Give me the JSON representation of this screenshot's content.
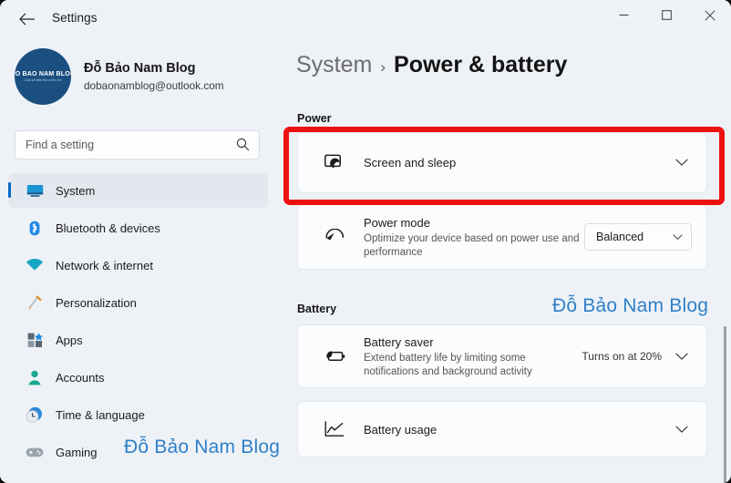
{
  "window": {
    "title": "Settings",
    "back_icon": "back-arrow-icon",
    "controls": {
      "minimize": "minimize-icon",
      "maximize": "maximize-icon",
      "close": "close-icon"
    }
  },
  "account": {
    "avatar_line1": "ĐO BAO NAM BLOG",
    "avatar_line2": "Chia sẻ kiến thức hữu ích",
    "name": "Đỗ Bảo Nam Blog",
    "email": "dobaonamblog@outlook.com"
  },
  "search": {
    "placeholder": "Find a setting",
    "value": "",
    "icon": "search-icon"
  },
  "sidebar": {
    "items": [
      {
        "label": "System",
        "icon": "monitor-icon",
        "active": true
      },
      {
        "label": "Bluetooth & devices",
        "icon": "bluetooth-icon",
        "active": false
      },
      {
        "label": "Network & internet",
        "icon": "wifi-icon",
        "active": false
      },
      {
        "label": "Personalization",
        "icon": "paintbrush-icon",
        "active": false
      },
      {
        "label": "Apps",
        "icon": "apps-grid-icon",
        "active": false
      },
      {
        "label": "Accounts",
        "icon": "person-icon",
        "active": false
      },
      {
        "label": "Time & language",
        "icon": "clock-icon",
        "active": false
      },
      {
        "label": "Gaming",
        "icon": "gamepad-icon",
        "active": false
      }
    ]
  },
  "breadcrumb": {
    "parent": "System",
    "separator": "›",
    "current": "Power & battery"
  },
  "sections": {
    "power_heading": "Power",
    "battery_heading": "Battery"
  },
  "cards": {
    "screen_and_sleep": {
      "title": "Screen and sleep",
      "icon": "screen-sleep-icon",
      "chevron": "chevron-down-icon",
      "highlighted": true
    },
    "power_mode": {
      "title": "Power mode",
      "subtitle": "Optimize your device based on power use and performance",
      "icon": "power-gauge-icon",
      "dropdown_value": "Balanced",
      "dropdown_chevron": "chevron-down-icon"
    },
    "battery_saver": {
      "title": "Battery saver",
      "subtitle": "Extend battery life by limiting some notifications and background activity",
      "icon": "battery-leaf-icon",
      "status": "Turns on at 20%",
      "chevron": "chevron-down-icon"
    },
    "battery_usage": {
      "title": "Battery usage",
      "icon": "line-chart-icon",
      "chevron": "chevron-down-icon"
    }
  },
  "watermark": {
    "text": "Đỗ Bảo Nam Blog",
    "color": "#2f80c8"
  },
  "colors": {
    "app_background": "#eef2f7",
    "card_background": "#fbfcfd",
    "accent": "#0067c0",
    "annotation": "#ee1111"
  }
}
